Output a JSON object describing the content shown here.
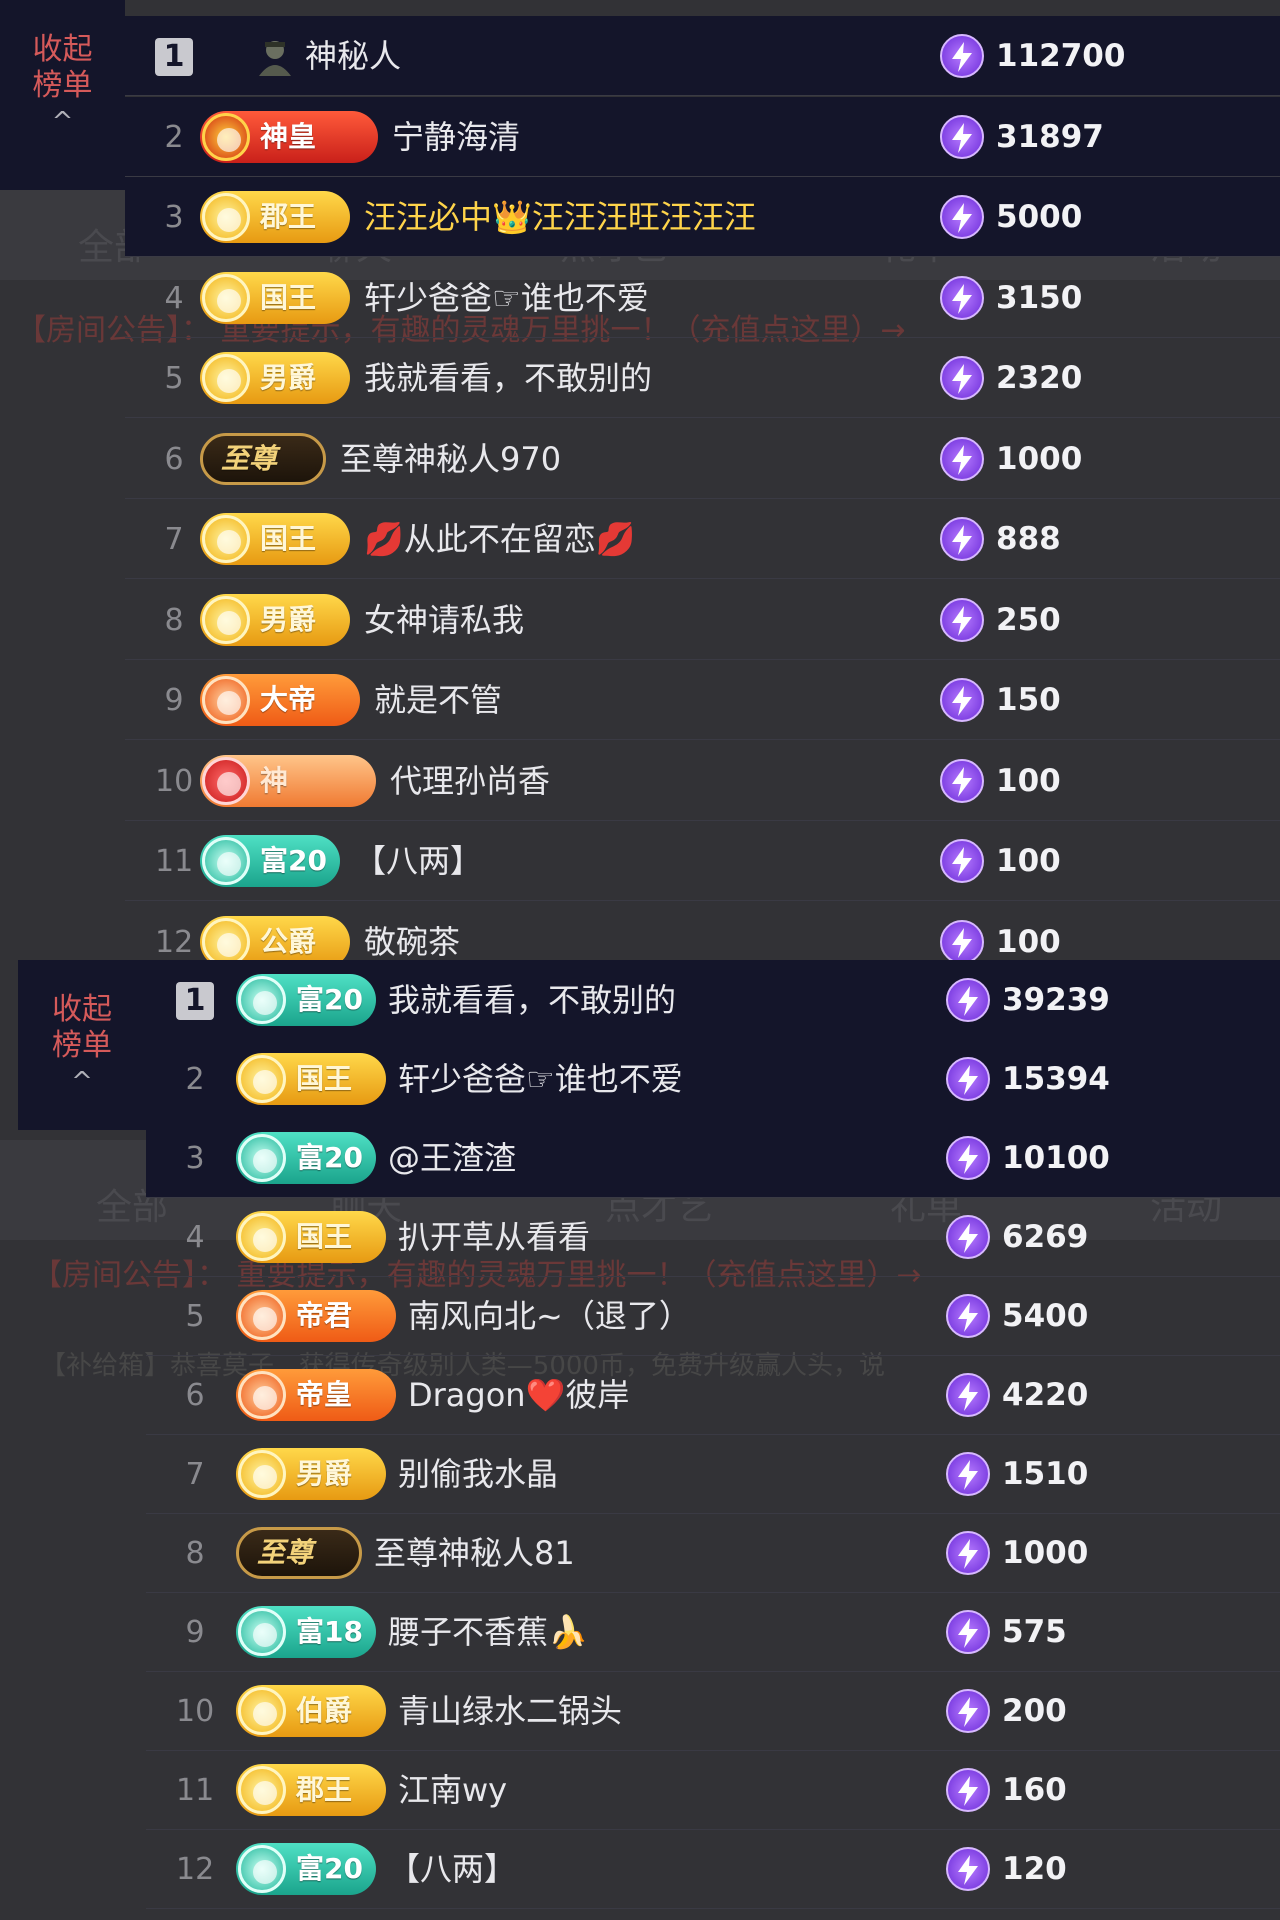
{
  "collapse_label_line1": "收起",
  "collapse_label_line2": "榜单",
  "chevron": "^",
  "background": {
    "tabs": [
      "全部",
      "聊天",
      "点才艺",
      "礼单",
      "活动"
    ],
    "notice": "【房间公告】：  重要提示，有趣的灵魂万里挑一！（充值点这里）→",
    "notice2": "【补给箱】恭喜莫子...获得传奇级别人类—5000币，免费升级赢人头，说"
  },
  "panels": [
    {
      "rows": [
        {
          "rank": "1",
          "badge": "",
          "badge_style": "none",
          "name": "神秘人",
          "score": "112700"
        },
        {
          "rank": "2",
          "badge": "神皇",
          "badge_style": "red",
          "name": "宁静海清",
          "score": "31897"
        },
        {
          "rank": "3",
          "badge": "郡王",
          "badge_style": "gold",
          "name": "汪汪必中👑汪汪汪旺汪汪汪",
          "score": "5000"
        },
        {
          "rank": "4",
          "badge": "国王",
          "badge_style": "gold",
          "name": "轩少爸爸☞谁也不爱",
          "score": "3150"
        },
        {
          "rank": "5",
          "badge": "男爵",
          "badge_style": "gold",
          "name": "我就看看，不敢别的",
          "score": "2320"
        },
        {
          "rank": "6",
          "badge": "至尊",
          "badge_style": "zz",
          "name": "至尊神秘人970",
          "score": "1000"
        },
        {
          "rank": "7",
          "badge": "国王",
          "badge_style": "gold",
          "name": "💋从此不在留恋💋",
          "score": "888"
        },
        {
          "rank": "8",
          "badge": "男爵",
          "badge_style": "gold",
          "name": "女神请私我",
          "score": "250"
        },
        {
          "rank": "9",
          "badge": "大帝",
          "badge_style": "orange",
          "name": "就是不管",
          "score": "150"
        },
        {
          "rank": "10",
          "badge": "神",
          "badge_style": "orange2",
          "name": "代理孙尚香",
          "score": "100"
        },
        {
          "rank": "11",
          "badge": "富20",
          "badge_style": "teal",
          "name": "【八两】",
          "score": "100"
        },
        {
          "rank": "12",
          "badge": "公爵",
          "badge_style": "gold",
          "name": "敬碗茶",
          "score": "100"
        }
      ]
    },
    {
      "rows": [
        {
          "rank": "1",
          "badge": "富20",
          "badge_style": "teal",
          "name": "我就看看，不敢别的",
          "score": "39239"
        },
        {
          "rank": "2",
          "badge": "国王",
          "badge_style": "gold",
          "name": "轩少爸爸☞谁也不爱",
          "score": "15394"
        },
        {
          "rank": "3",
          "badge": "富20",
          "badge_style": "teal",
          "name": "@王渣渣",
          "score": "10100"
        },
        {
          "rank": "4",
          "badge": "国王",
          "badge_style": "gold",
          "name": "扒开草从看看",
          "score": "6269"
        },
        {
          "rank": "5",
          "badge": "帝君",
          "badge_style": "orange",
          "name": "南风向北~（退了）",
          "score": "5400"
        },
        {
          "rank": "6",
          "badge": "帝皇",
          "badge_style": "orange",
          "name": "Dragon❤️彼岸",
          "score": "4220"
        },
        {
          "rank": "7",
          "badge": "男爵",
          "badge_style": "gold",
          "name": "别偷我水晶",
          "score": "1510"
        },
        {
          "rank": "8",
          "badge": "至尊",
          "badge_style": "zz",
          "name": "至尊神秘人81",
          "score": "1000"
        },
        {
          "rank": "9",
          "badge": "富18",
          "badge_style": "teal",
          "name": "腰子不香蕉🍌",
          "score": "575"
        },
        {
          "rank": "10",
          "badge": "伯爵",
          "badge_style": "gold",
          "name": "青山绿水二锅头",
          "score": "200"
        },
        {
          "rank": "11",
          "badge": "郡王",
          "badge_style": "gold",
          "name": "江南wy",
          "score": "160"
        },
        {
          "rank": "12",
          "badge": "富20",
          "badge_style": "teal",
          "name": "【八两】",
          "score": "120"
        }
      ]
    }
  ],
  "icons": {
    "score": "lightning-coin-icon",
    "mystery": "mystery-person-icon"
  },
  "colors": {
    "row_dark": "#14152a",
    "score_coin": "#8a4cf0",
    "gold_name": "#ffd44a"
  }
}
